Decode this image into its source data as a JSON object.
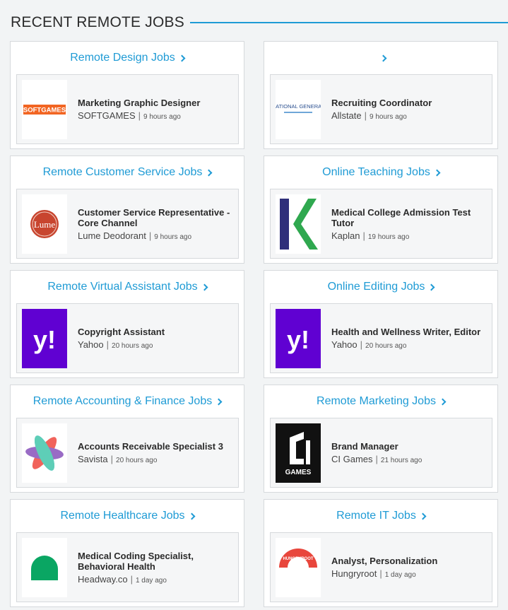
{
  "section_title": "RECENT REMOTE JOBS",
  "colors": {
    "accent": "#1f9bd5"
  },
  "cards": [
    {
      "category": "Remote Design Jobs",
      "job_title": "Marketing Graphic Designer",
      "company": "SOFTGAMES",
      "posted": "9 hours ago",
      "logo": "softgames-logo",
      "logo_text": "SOFTGAMES"
    },
    {
      "category": "",
      "job_title": "Recruiting Coordinator",
      "company": "Allstate",
      "posted": "9 hours ago",
      "logo": "national-general-logo",
      "logo_text": "NATIONAL GENERAL"
    },
    {
      "category": "Remote Customer Service Jobs",
      "job_title": "Customer Service Representative - Core Channel",
      "company": "Lume Deodorant",
      "posted": "9 hours ago",
      "logo": "lume-logo",
      "logo_text": "Lume"
    },
    {
      "category": "Online Teaching Jobs",
      "job_title": "Medical College Admission Test Tutor",
      "company": "Kaplan",
      "posted": "19 hours ago",
      "logo": "kaplan-logo",
      "logo_text": ""
    },
    {
      "category": "Remote Virtual Assistant Jobs",
      "job_title": "Copyright Assistant",
      "company": "Yahoo",
      "posted": "20 hours ago",
      "logo": "yahoo-logo",
      "logo_text": "y!"
    },
    {
      "category": "Online Editing Jobs",
      "job_title": "Health and Wellness Writer, Editor",
      "company": "Yahoo",
      "posted": "20 hours ago",
      "logo": "yahoo-logo",
      "logo_text": "y!"
    },
    {
      "category": "Remote Accounting & Finance Jobs",
      "job_title": "Accounts Receivable Specialist 3",
      "company": "Savista",
      "posted": "20 hours ago",
      "logo": "savista-logo",
      "logo_text": ""
    },
    {
      "category": "Remote Marketing Jobs",
      "job_title": "Brand Manager",
      "company": "CI Games",
      "posted": "21 hours ago",
      "logo": "ci-games-logo",
      "logo_text": "GAMES"
    },
    {
      "category": "Remote Healthcare Jobs",
      "job_title": "Medical Coding Specialist, Behavioral Health",
      "company": "Headway.co",
      "posted": "1 day ago",
      "logo": "headway-logo",
      "logo_text": ""
    },
    {
      "category": "Remote IT Jobs",
      "job_title": "Analyst, Personalization",
      "company": "Hungryroot",
      "posted": "1 day ago",
      "logo": "hungryroot-logo",
      "logo_text": "HUNGRYROOT"
    }
  ]
}
